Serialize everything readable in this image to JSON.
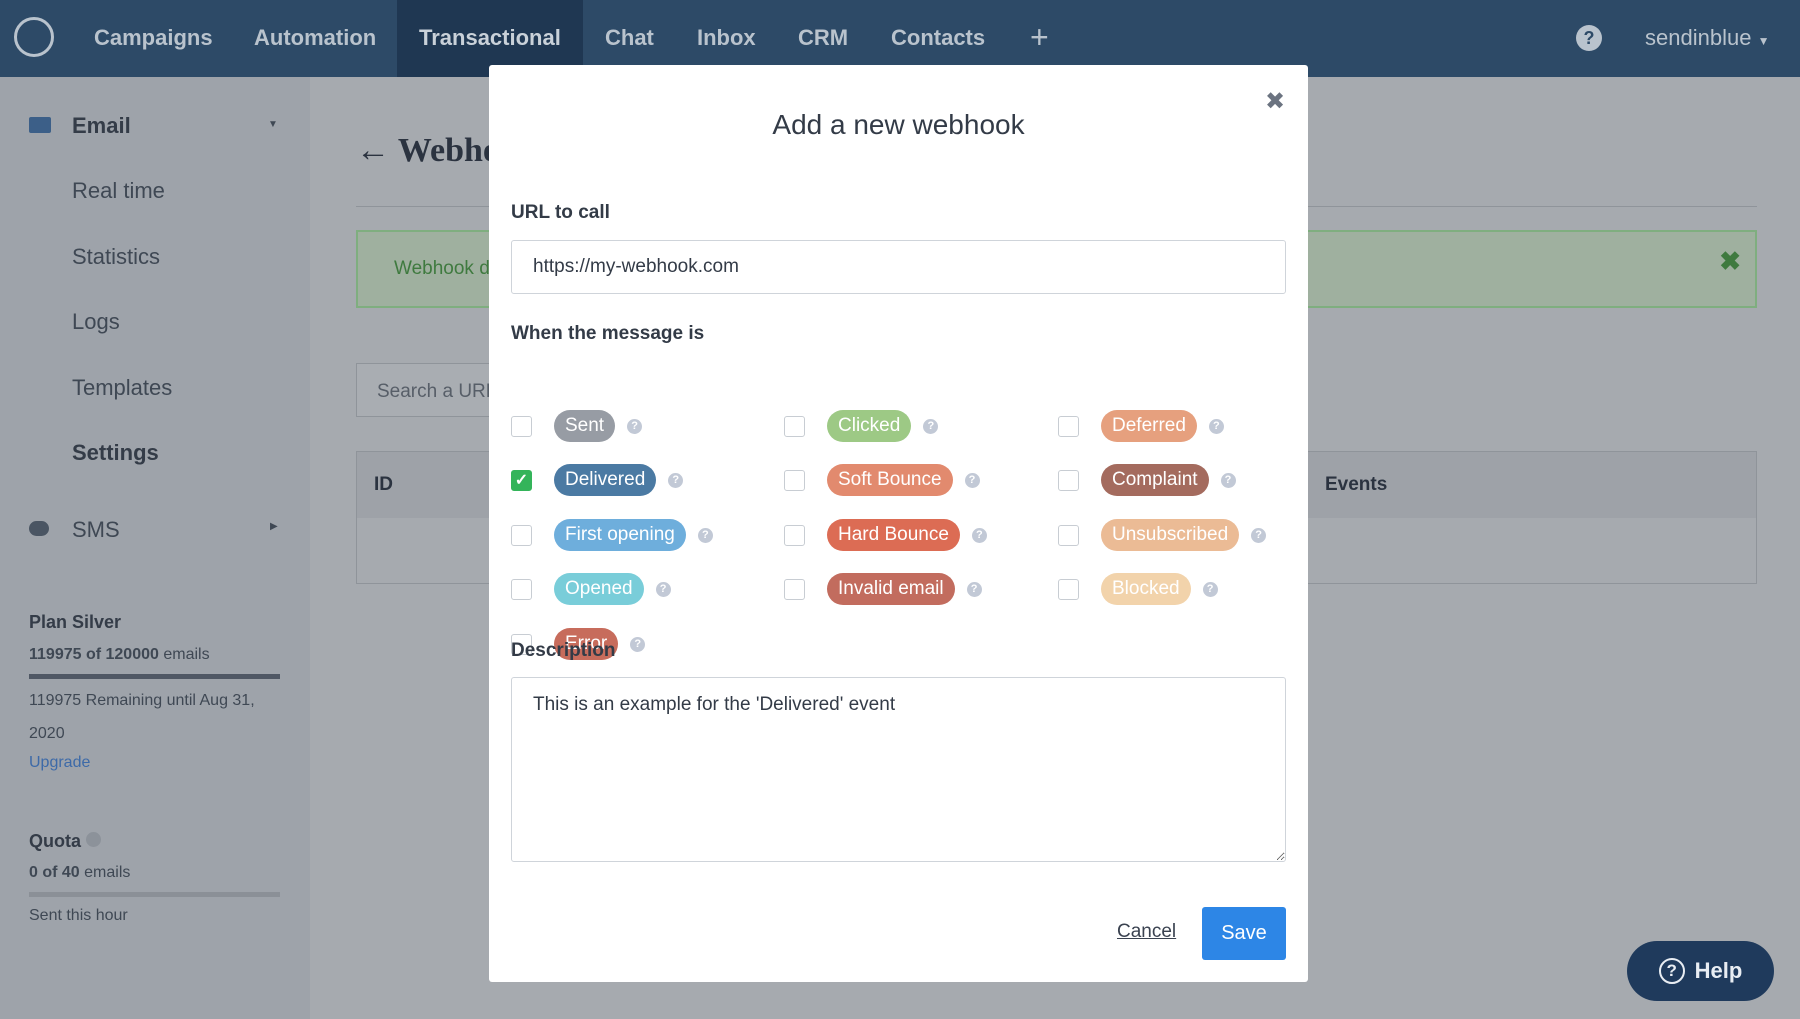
{
  "nav": {
    "items": [
      "Campaigns",
      "Automation",
      "Transactional",
      "Chat",
      "Inbox",
      "CRM",
      "Contacts"
    ],
    "active": "Transactional",
    "plus": "+",
    "account": "sendinblue"
  },
  "sidebar": {
    "email": "Email",
    "items": [
      "Real time",
      "Statistics",
      "Logs",
      "Templates",
      "Settings"
    ],
    "active": "Settings",
    "sms": "SMS",
    "plan": {
      "title": "Plan Silver",
      "usage_bold": "119975 of 120000",
      "usage_unit": "emails",
      "progress": 0.9998,
      "remaining": "119975 Remaining until Aug 31, 2020",
      "upgrade": "Upgrade"
    },
    "quota": {
      "title": "Quota",
      "usage_bold": "0 of 40",
      "usage_unit": "emails",
      "progress": 0,
      "note": "Sent this hour"
    }
  },
  "main": {
    "title": "Webhooks",
    "alert": "Webhook d",
    "search_placeholder": "Search a URL",
    "table": {
      "col_id": "ID",
      "col_events": "Events"
    }
  },
  "modal": {
    "title": "Add a new webhook",
    "url_label": "URL to call",
    "url_value": "https://my-webhook.com",
    "events_label": "When the message is",
    "events": [
      {
        "label": "Sent",
        "color": "#979ca4",
        "checked": false
      },
      {
        "label": "Clicked",
        "color": "#9dc985",
        "checked": false
      },
      {
        "label": "Deferred",
        "color": "#e6a07e",
        "checked": false
      },
      {
        "label": "Delivered",
        "color": "#4b7aa3",
        "checked": true
      },
      {
        "label": "Soft Bounce",
        "color": "#e28a6e",
        "checked": false
      },
      {
        "label": "Complaint",
        "color": "#a46b5e",
        "checked": false
      },
      {
        "label": "First opening",
        "color": "#6eaedc",
        "checked": false
      },
      {
        "label": "Hard Bounce",
        "color": "#dc6c54",
        "checked": false
      },
      {
        "label": "Unsubscribed",
        "color": "#ebbb95",
        "checked": false
      },
      {
        "label": "Opened",
        "color": "#79cdd9",
        "checked": false
      },
      {
        "label": "Invalid email",
        "color": "#c26c5e",
        "checked": false
      },
      {
        "label": "Blocked",
        "color": "#f2d3ab",
        "checked": false
      },
      {
        "label": "Error",
        "color": "#c76c5c",
        "checked": false
      }
    ],
    "description_label": "Description",
    "description_value": "This is an example for the 'Delivered' event",
    "cancel": "Cancel",
    "save": "Save"
  },
  "help": "Help",
  "colors": {
    "accent": "#2d86e6",
    "success": "#34b45a"
  }
}
